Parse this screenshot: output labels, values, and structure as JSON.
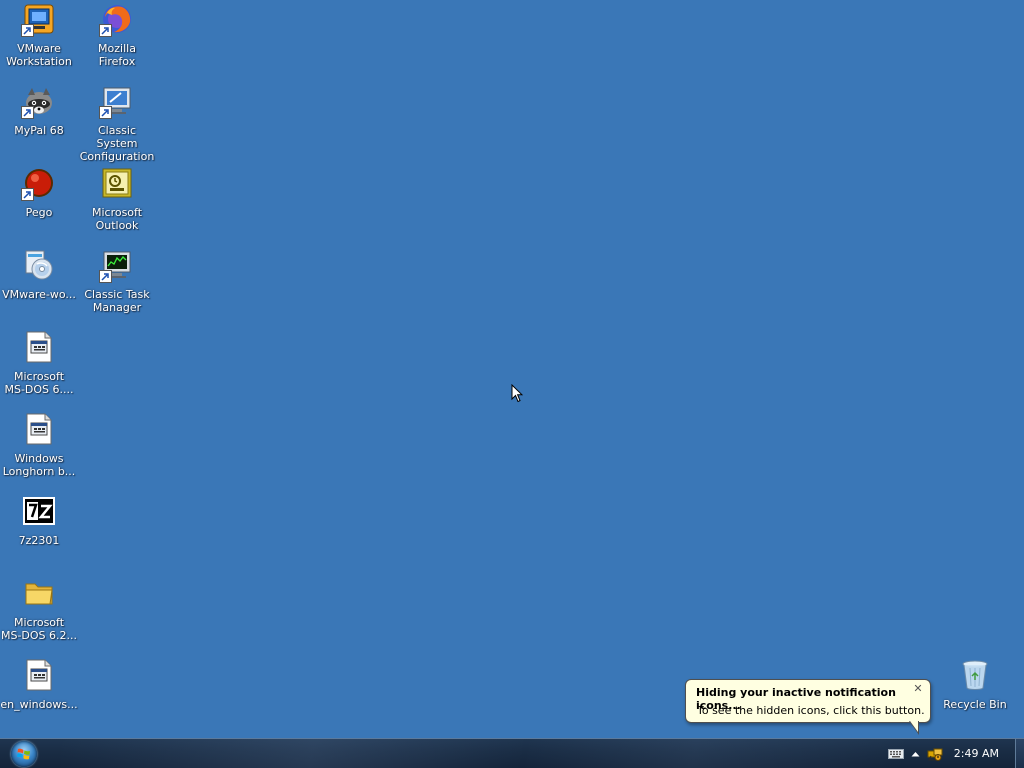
{
  "desktop": {
    "icons": [
      {
        "id": "vmware-workstation",
        "label": "VMware\nWorkstation",
        "icon": "vmware-workstation-icon",
        "shortcut": true
      },
      {
        "id": "mozilla-firefox",
        "label": "Mozilla\nFirefox",
        "icon": "firefox-icon",
        "shortcut": true
      },
      {
        "id": "mypal-68",
        "label": "MyPal 68",
        "icon": "mypal-raccoon-icon",
        "shortcut": true
      },
      {
        "id": "classic-system-configuration",
        "label": "Classic System\nConfiguration",
        "icon": "system-configuration-icon",
        "shortcut": true
      },
      {
        "id": "pego",
        "label": "Pego",
        "icon": "pego-red-ball-icon",
        "shortcut": true
      },
      {
        "id": "microsoft-outlook",
        "label": "Microsoft\nOutlook",
        "icon": "outlook-icon",
        "shortcut": false
      },
      {
        "id": "vmware-wo",
        "label": "VMware-wo...",
        "icon": "installer-disc-icon",
        "shortcut": false
      },
      {
        "id": "classic-task-manager",
        "label": "Classic Task\nManager",
        "icon": "task-manager-icon",
        "shortcut": true
      },
      {
        "id": "microsoft-ms-dos-6-file",
        "label": "Microsoft\nMS-DOS 6....",
        "icon": "disk-image-file-icon",
        "shortcut": false
      },
      {
        "id": "windows-longhorn",
        "label": "Windows\nLonghorn b...",
        "icon": "disk-image-file-icon",
        "shortcut": false
      },
      {
        "id": "7z2301",
        "label": "7z2301",
        "icon": "7zip-icon",
        "shortcut": false
      },
      {
        "id": "microsoft-ms-dos-6-2-folder",
        "label": "Microsoft\nMS-DOS 6.2...",
        "icon": "folder-icon",
        "shortcut": false
      },
      {
        "id": "en-windows",
        "label": "en_windows...",
        "icon": "disk-image-file-icon",
        "shortcut": false
      },
      {
        "id": "recycle-bin",
        "label": "Recycle Bin",
        "icon": "recycle-bin-icon",
        "shortcut": false
      }
    ]
  },
  "balloon": {
    "title": "Hiding your inactive notification icons...",
    "text": "To see the hidden icons, click this button.",
    "close_glyph": "✕",
    "background": "#ffffe1"
  },
  "taskbar": {
    "clock": "2:49 AM",
    "tray_icons": [
      "keyboard-icon",
      "show-hidden-icons-arrow-icon",
      "network-alert-icon"
    ]
  },
  "colors": {
    "desktop_background": "#3a77b7",
    "taskbar": "#1a2d45",
    "label_text": "#ffffff"
  }
}
